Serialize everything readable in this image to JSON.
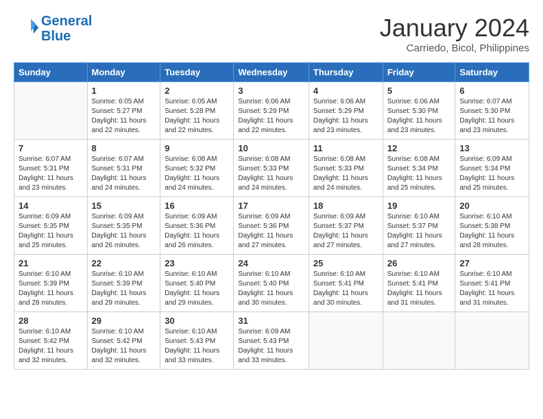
{
  "header": {
    "logo_line1": "General",
    "logo_line2": "Blue",
    "month": "January 2024",
    "location": "Carriedo, Bicol, Philippines"
  },
  "days_of_week": [
    "Sunday",
    "Monday",
    "Tuesday",
    "Wednesday",
    "Thursday",
    "Friday",
    "Saturday"
  ],
  "weeks": [
    [
      {
        "day": "",
        "info": ""
      },
      {
        "day": "1",
        "info": "Sunrise: 6:05 AM\nSunset: 5:27 PM\nDaylight: 11 hours\nand 22 minutes."
      },
      {
        "day": "2",
        "info": "Sunrise: 6:05 AM\nSunset: 5:28 PM\nDaylight: 11 hours\nand 22 minutes."
      },
      {
        "day": "3",
        "info": "Sunrise: 6:06 AM\nSunset: 5:29 PM\nDaylight: 11 hours\nand 22 minutes."
      },
      {
        "day": "4",
        "info": "Sunrise: 6:06 AM\nSunset: 5:29 PM\nDaylight: 11 hours\nand 23 minutes."
      },
      {
        "day": "5",
        "info": "Sunrise: 6:06 AM\nSunset: 5:30 PM\nDaylight: 11 hours\nand 23 minutes."
      },
      {
        "day": "6",
        "info": "Sunrise: 6:07 AM\nSunset: 5:30 PM\nDaylight: 11 hours\nand 23 minutes."
      }
    ],
    [
      {
        "day": "7",
        "info": "Sunrise: 6:07 AM\nSunset: 5:31 PM\nDaylight: 11 hours\nand 23 minutes."
      },
      {
        "day": "8",
        "info": "Sunrise: 6:07 AM\nSunset: 5:31 PM\nDaylight: 11 hours\nand 24 minutes."
      },
      {
        "day": "9",
        "info": "Sunrise: 6:08 AM\nSunset: 5:32 PM\nDaylight: 11 hours\nand 24 minutes."
      },
      {
        "day": "10",
        "info": "Sunrise: 6:08 AM\nSunset: 5:33 PM\nDaylight: 11 hours\nand 24 minutes."
      },
      {
        "day": "11",
        "info": "Sunrise: 6:08 AM\nSunset: 5:33 PM\nDaylight: 11 hours\nand 24 minutes."
      },
      {
        "day": "12",
        "info": "Sunrise: 6:08 AM\nSunset: 5:34 PM\nDaylight: 11 hours\nand 25 minutes."
      },
      {
        "day": "13",
        "info": "Sunrise: 6:09 AM\nSunset: 5:34 PM\nDaylight: 11 hours\nand 25 minutes."
      }
    ],
    [
      {
        "day": "14",
        "info": "Sunrise: 6:09 AM\nSunset: 5:35 PM\nDaylight: 11 hours\nand 25 minutes."
      },
      {
        "day": "15",
        "info": "Sunrise: 6:09 AM\nSunset: 5:35 PM\nDaylight: 11 hours\nand 26 minutes."
      },
      {
        "day": "16",
        "info": "Sunrise: 6:09 AM\nSunset: 5:36 PM\nDaylight: 11 hours\nand 26 minutes."
      },
      {
        "day": "17",
        "info": "Sunrise: 6:09 AM\nSunset: 5:36 PM\nDaylight: 11 hours\nand 27 minutes."
      },
      {
        "day": "18",
        "info": "Sunrise: 6:09 AM\nSunset: 5:37 PM\nDaylight: 11 hours\nand 27 minutes."
      },
      {
        "day": "19",
        "info": "Sunrise: 6:10 AM\nSunset: 5:37 PM\nDaylight: 11 hours\nand 27 minutes."
      },
      {
        "day": "20",
        "info": "Sunrise: 6:10 AM\nSunset: 5:38 PM\nDaylight: 11 hours\nand 28 minutes."
      }
    ],
    [
      {
        "day": "21",
        "info": "Sunrise: 6:10 AM\nSunset: 5:39 PM\nDaylight: 11 hours\nand 28 minutes."
      },
      {
        "day": "22",
        "info": "Sunrise: 6:10 AM\nSunset: 5:39 PM\nDaylight: 11 hours\nand 29 minutes."
      },
      {
        "day": "23",
        "info": "Sunrise: 6:10 AM\nSunset: 5:40 PM\nDaylight: 11 hours\nand 29 minutes."
      },
      {
        "day": "24",
        "info": "Sunrise: 6:10 AM\nSunset: 5:40 PM\nDaylight: 11 hours\nand 30 minutes."
      },
      {
        "day": "25",
        "info": "Sunrise: 6:10 AM\nSunset: 5:41 PM\nDaylight: 11 hours\nand 30 minutes."
      },
      {
        "day": "26",
        "info": "Sunrise: 6:10 AM\nSunset: 5:41 PM\nDaylight: 11 hours\nand 31 minutes."
      },
      {
        "day": "27",
        "info": "Sunrise: 6:10 AM\nSunset: 5:41 PM\nDaylight: 11 hours\nand 31 minutes."
      }
    ],
    [
      {
        "day": "28",
        "info": "Sunrise: 6:10 AM\nSunset: 5:42 PM\nDaylight: 11 hours\nand 32 minutes."
      },
      {
        "day": "29",
        "info": "Sunrise: 6:10 AM\nSunset: 5:42 PM\nDaylight: 11 hours\nand 32 minutes."
      },
      {
        "day": "30",
        "info": "Sunrise: 6:10 AM\nSunset: 5:43 PM\nDaylight: 11 hours\nand 33 minutes."
      },
      {
        "day": "31",
        "info": "Sunrise: 6:09 AM\nSunset: 5:43 PM\nDaylight: 11 hours\nand 33 minutes."
      },
      {
        "day": "",
        "info": ""
      },
      {
        "day": "",
        "info": ""
      },
      {
        "day": "",
        "info": ""
      }
    ]
  ]
}
